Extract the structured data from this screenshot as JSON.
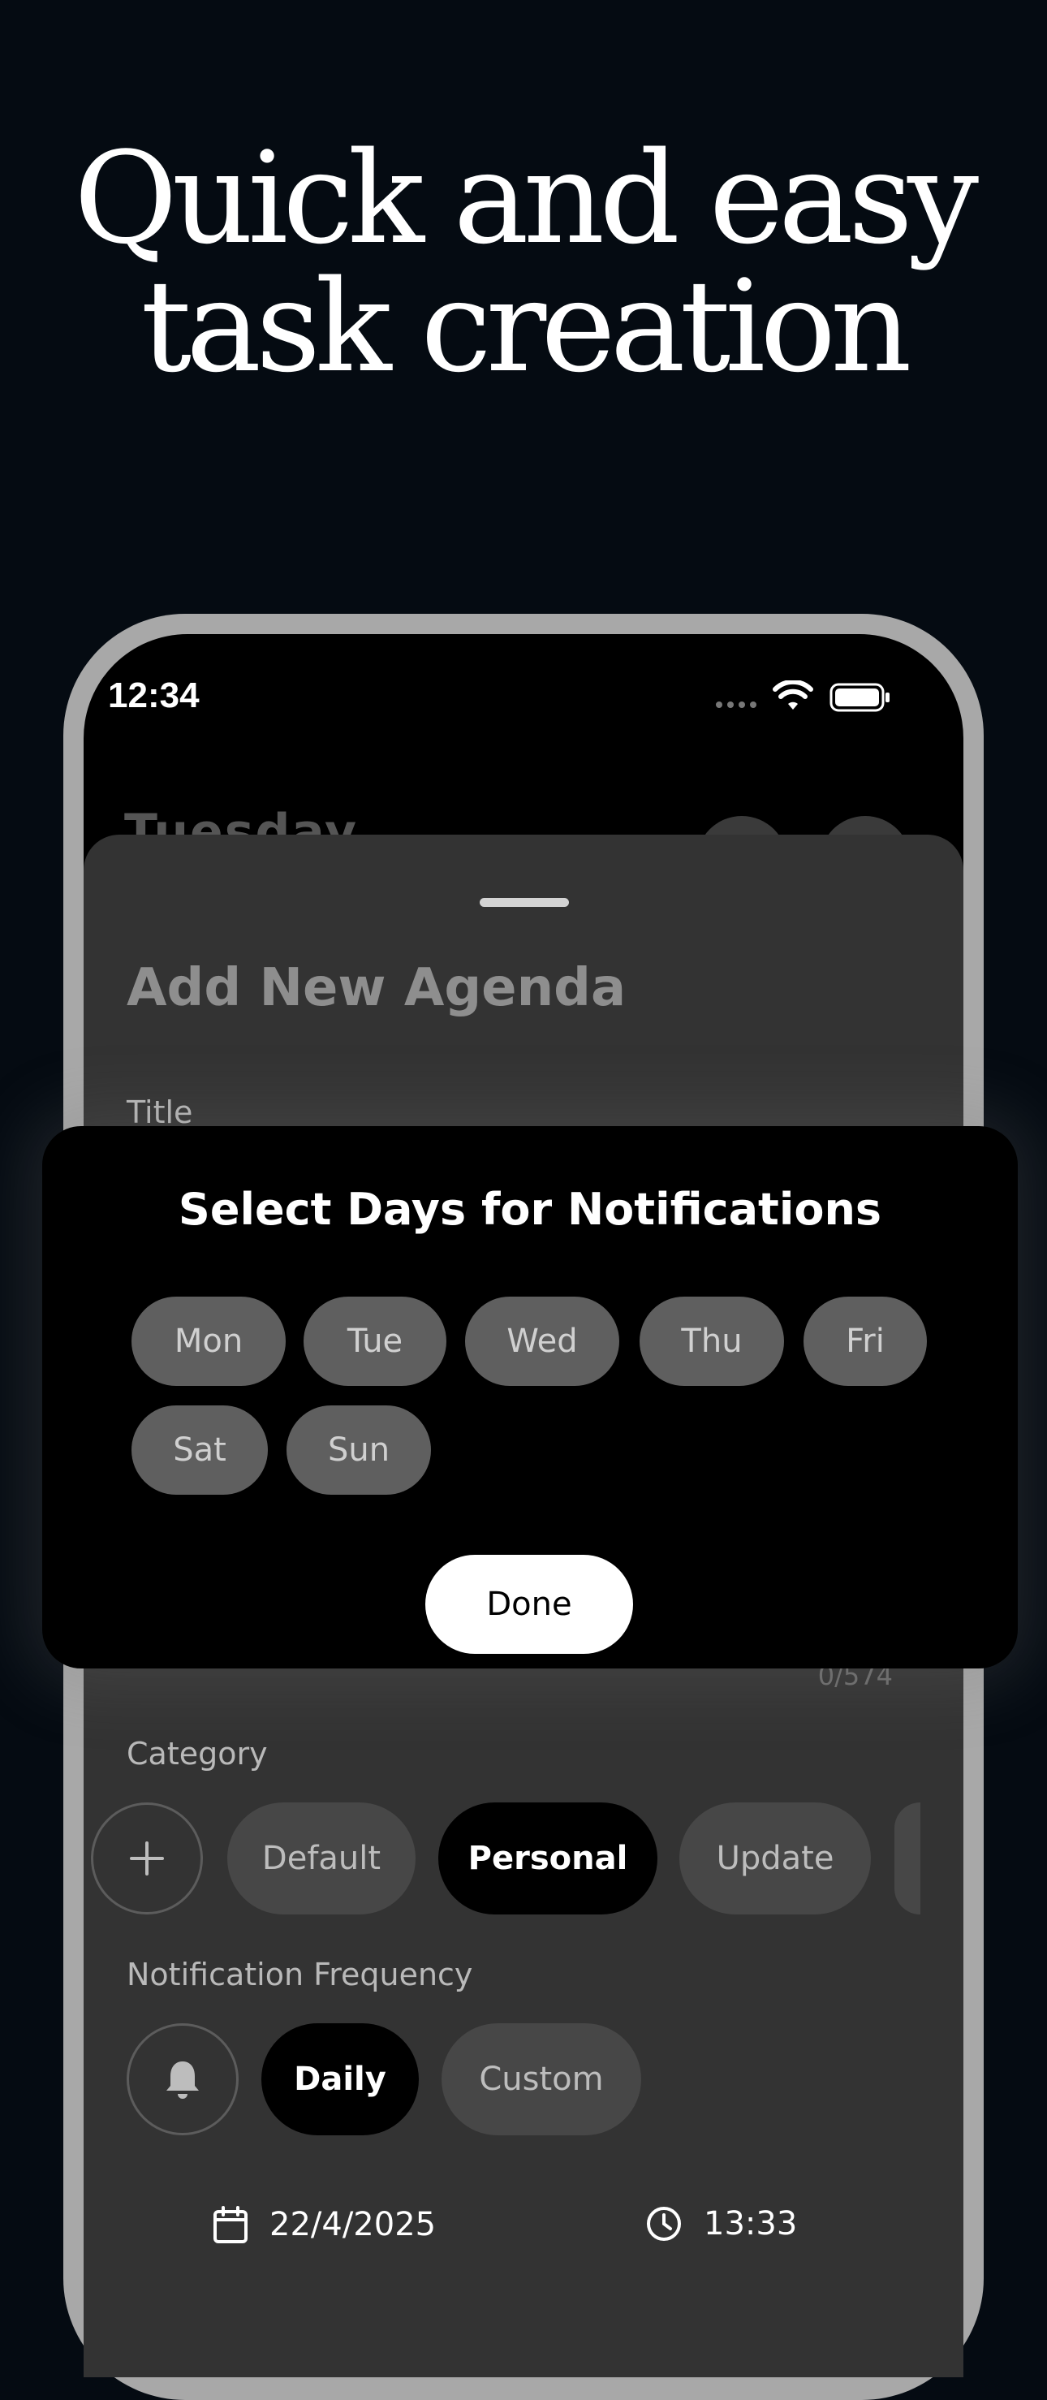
{
  "headline": {
    "line1": "Quick and easy",
    "line2": "task creation"
  },
  "status_bar": {
    "time": "12:34"
  },
  "background_screen": {
    "title": "Tuesday"
  },
  "sheet": {
    "title": "Add New Agenda",
    "title_label": "Title",
    "char_counter": "0/574",
    "category_label": "Category",
    "categories": [
      "Default",
      "Personal",
      "Update"
    ],
    "selected_category": "Personal",
    "notification_label": "Notification Frequency",
    "frequencies": [
      "Daily",
      "Custom"
    ],
    "selected_frequency": "Daily",
    "date": "22/4/2025",
    "time": "13:33"
  },
  "modal": {
    "title": "Select Days for Notifications",
    "days": [
      "Mon",
      "Tue",
      "Wed",
      "Thu",
      "Fri",
      "Sat",
      "Sun"
    ],
    "done_label": "Done"
  }
}
